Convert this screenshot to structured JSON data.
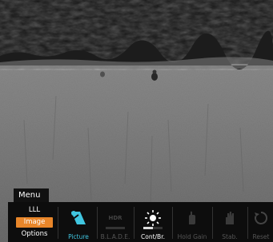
{
  "menu": {
    "title": "Menu",
    "modes": [
      {
        "label": "LLL",
        "active": false
      },
      {
        "label": "Image",
        "active": true
      },
      {
        "label": "Options",
        "active": false
      }
    ],
    "items": [
      {
        "label": "Picture",
        "icon": "picture-icon",
        "state": "selected"
      },
      {
        "label": "B.L.A.D.E.",
        "icon": "hdr-icon",
        "icon_text": "HDR",
        "state": "disabled"
      },
      {
        "label": "Cont/Br.",
        "icon": "brightness-icon",
        "state": "enabled",
        "level": 0.5
      },
      {
        "label": "Hold Gain",
        "icon": "hand-icon",
        "state": "disabled"
      },
      {
        "label": "Stab.",
        "icon": "stabilization-icon",
        "state": "disabled"
      },
      {
        "label": "Reset",
        "icon": "reset-icon",
        "state": "disabled"
      }
    ]
  },
  "colors": {
    "accent": "#e8862a",
    "selected": "#40c6e0",
    "bar": "#0d0d0d"
  }
}
